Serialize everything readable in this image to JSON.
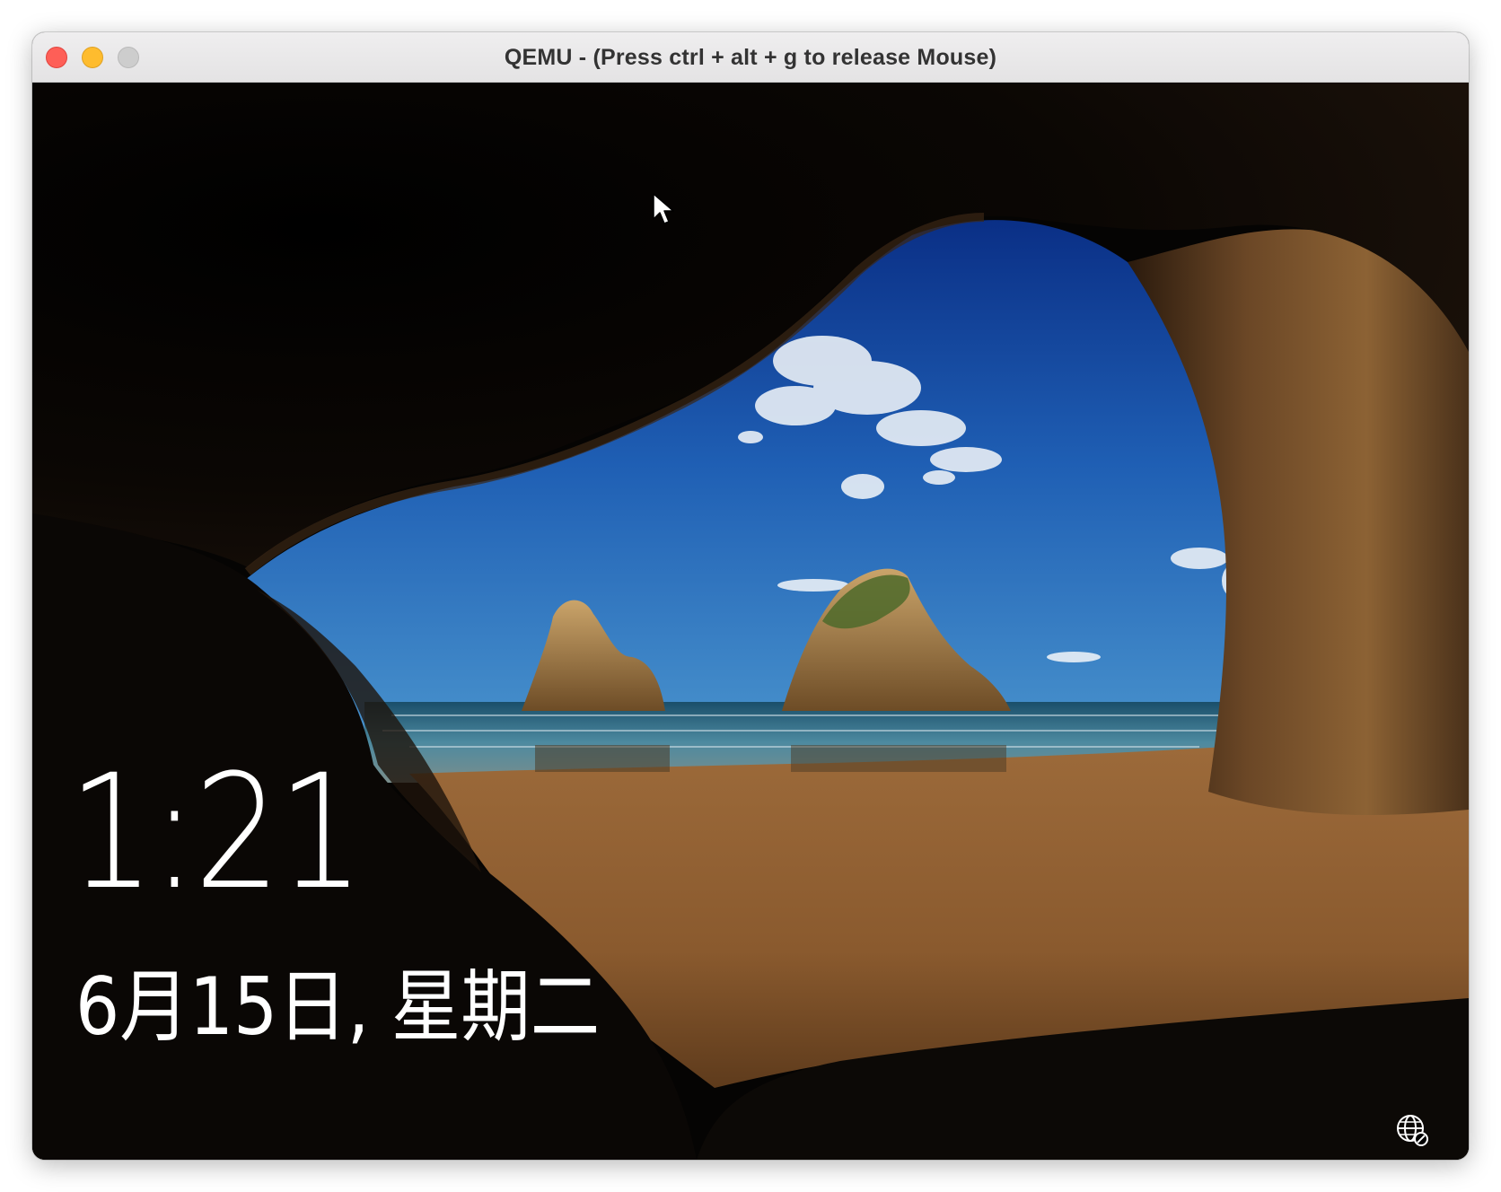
{
  "window": {
    "title": "QEMU - (Press ctrl + alt + g to release Mouse)",
    "controls": [
      "close",
      "minimize",
      "zoom"
    ]
  },
  "lock_screen": {
    "time": "1:21",
    "date": "6月15日, 星期二",
    "network_icon": "globe-network-icon",
    "wallpaper": "sea-cave-beach"
  },
  "colors": {
    "close": "#fe5f57",
    "minimize": "#febc2e",
    "zoom": "#cdcdcd",
    "text": "#ffffff"
  }
}
